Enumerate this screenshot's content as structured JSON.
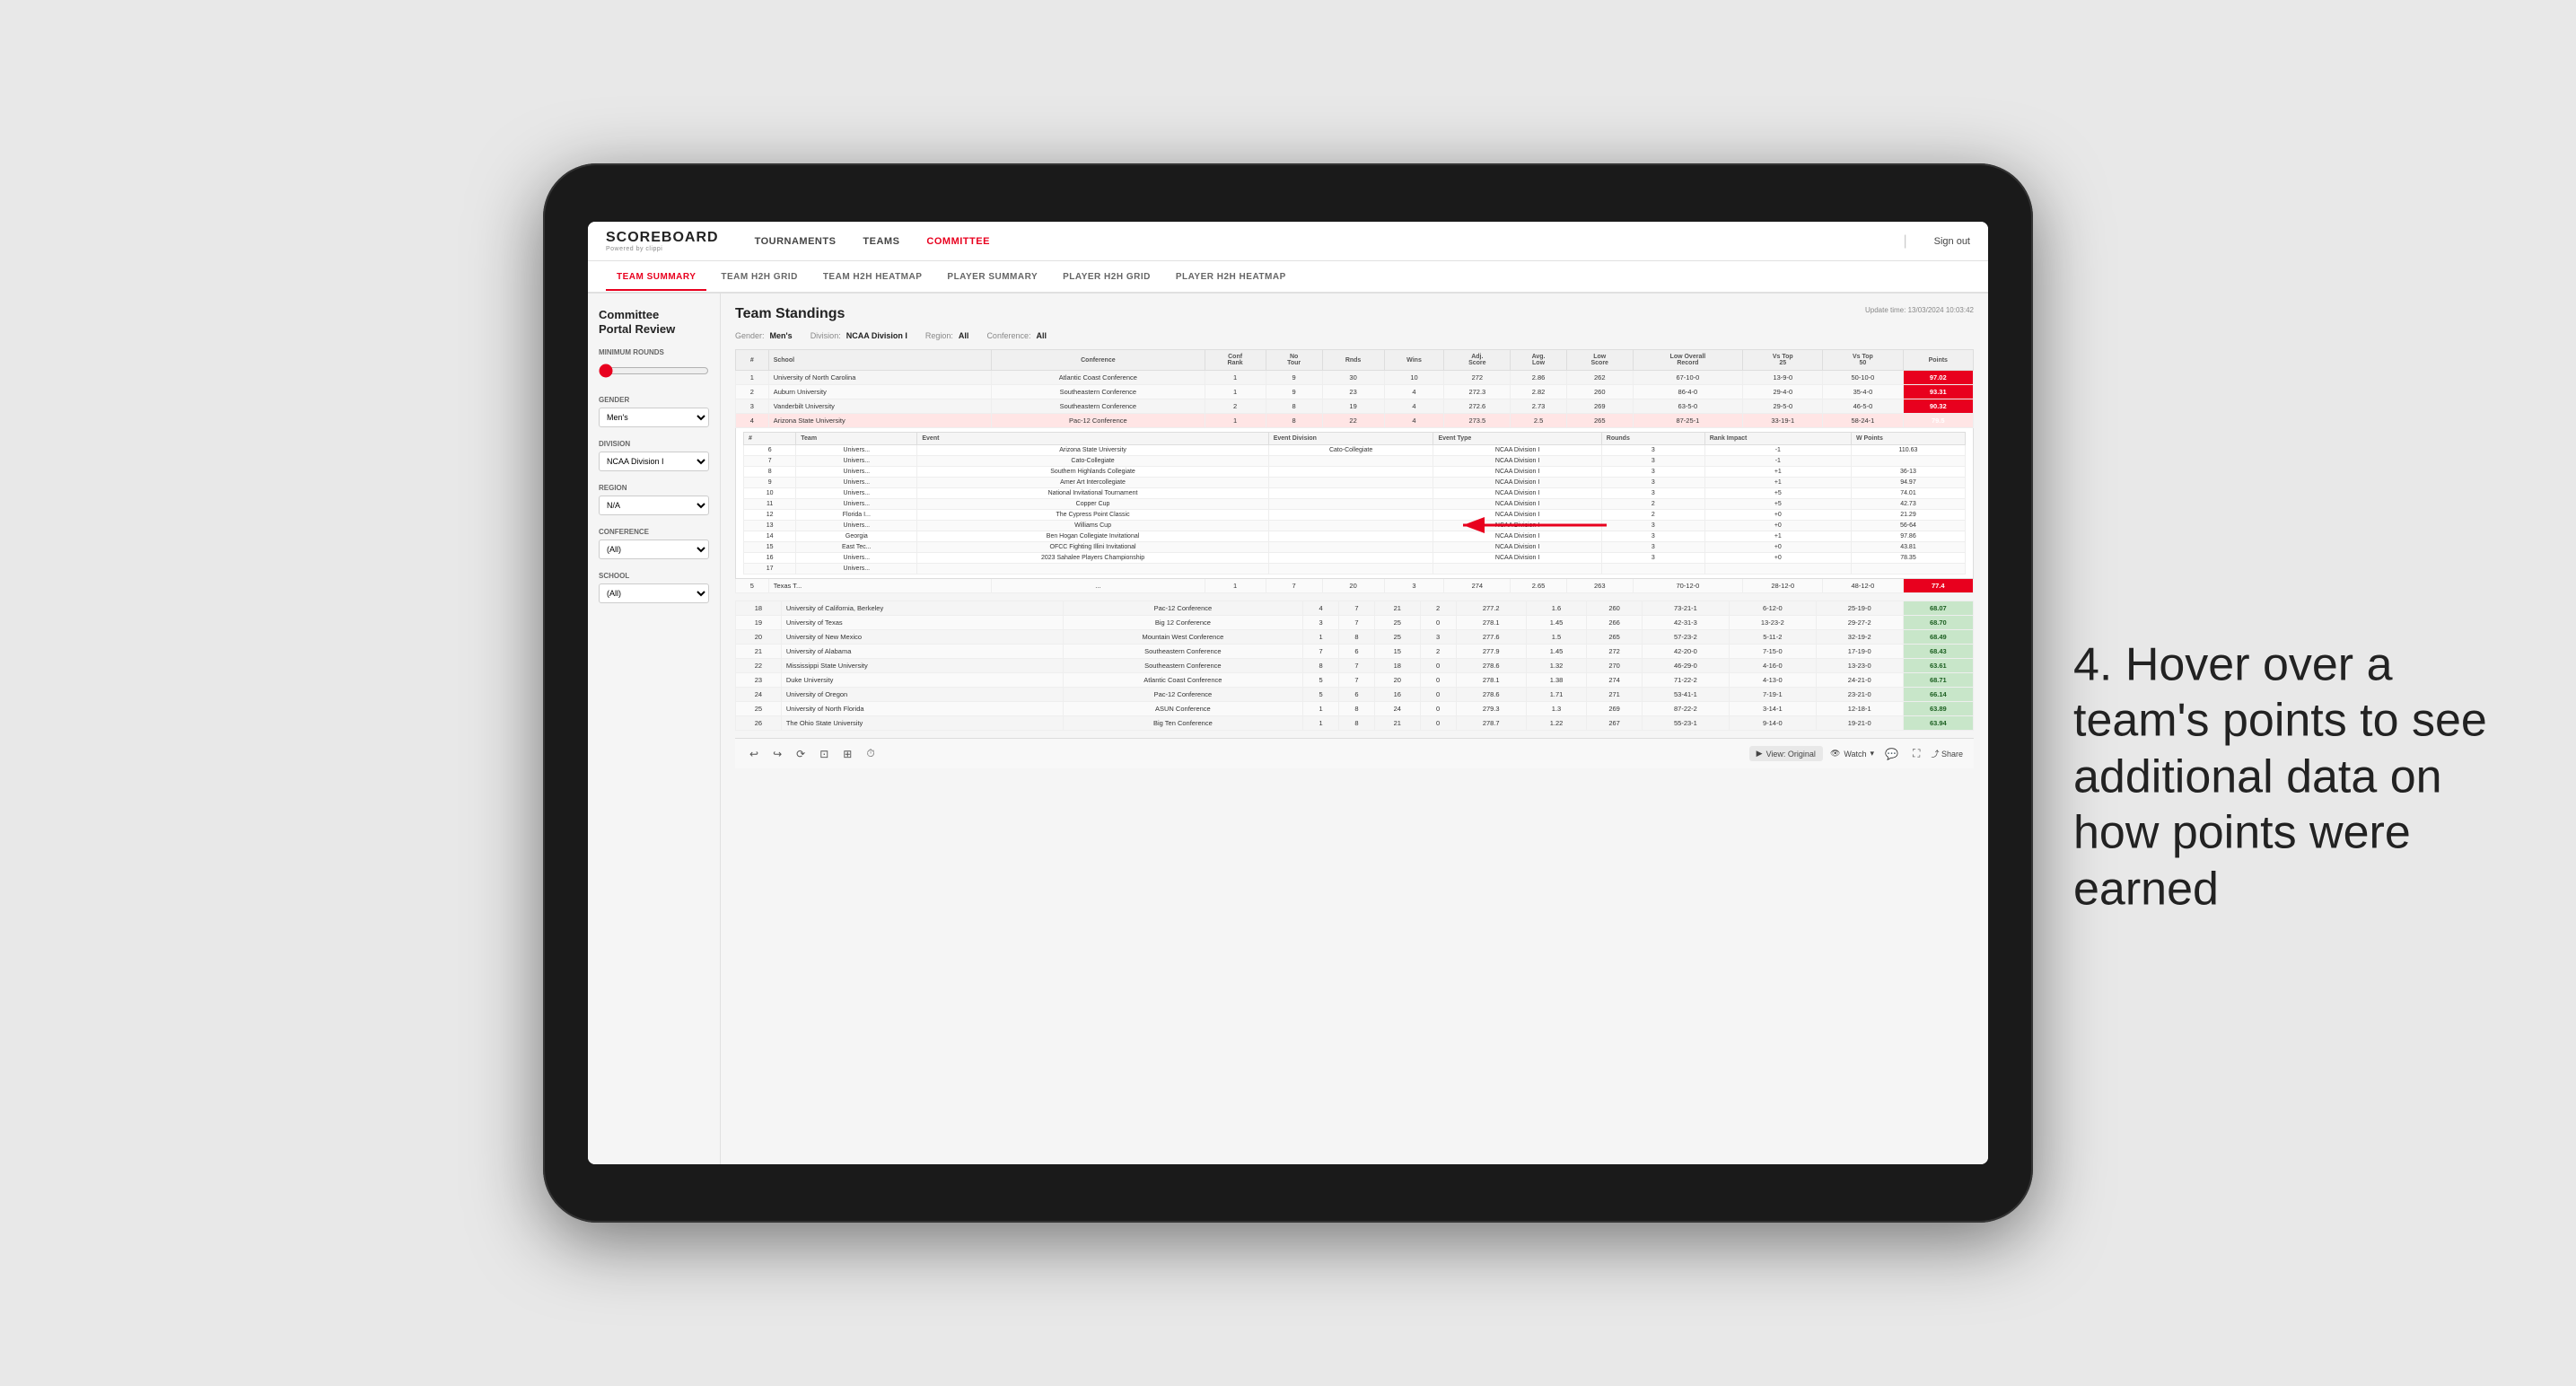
{
  "app": {
    "logo": "SCOREBOARD",
    "logo_sub": "Powered by clippi",
    "sign_out": "Sign out"
  },
  "nav": {
    "items": [
      {
        "label": "TOURNAMENTS",
        "active": false
      },
      {
        "label": "TEAMS",
        "active": false
      },
      {
        "label": "COMMITTEE",
        "active": true
      }
    ]
  },
  "sub_tabs": [
    {
      "label": "TEAM SUMMARY",
      "active": true
    },
    {
      "label": "TEAM H2H GRID",
      "active": false
    },
    {
      "label": "TEAM H2H HEATMAP",
      "active": false
    },
    {
      "label": "PLAYER SUMMARY",
      "active": false
    },
    {
      "label": "PLAYER H2H GRID",
      "active": false
    },
    {
      "label": "PLAYER H2H HEATMAP",
      "active": false
    }
  ],
  "sidebar": {
    "portal_title": "Committee",
    "portal_subtitle": "Portal Review",
    "min_rounds_label": "Minimum Rounds",
    "min_rounds_value": "0",
    "gender_label": "Gender",
    "gender_value": "Men's",
    "division_label": "Division",
    "division_value": "NCAA Division I",
    "region_label": "Region",
    "region_value": "N/A",
    "conference_label": "Conference",
    "conference_value": "(All)",
    "school_label": "School",
    "school_value": "(All)"
  },
  "panel": {
    "title": "Team Standings",
    "update_label": "Update time:",
    "update_time": "13/03/2024 10:03:42",
    "gender_label": "Gender:",
    "gender_value": "Men's",
    "division_label": "Division:",
    "division_value": "NCAA Division I",
    "region_label": "Region:",
    "region_value": "All",
    "conference_label": "Conference:",
    "conference_value": "All"
  },
  "table_headers": [
    "#",
    "School",
    "Conference",
    "Conf Rank",
    "No Tour",
    "Rnds",
    "Wins",
    "Adj Score",
    "Avg Low Score",
    "Low Overall Record",
    "Vs Top 25",
    "Vs Top 50",
    "Points"
  ],
  "teams": [
    {
      "rank": 1,
      "school": "University of North Carolina",
      "conference": "Atlantic Coast Conference",
      "conf_rank": 1,
      "tours": 9,
      "rounds": 30,
      "wins": 10,
      "adj_score": 272.0,
      "avg_low": 2.86,
      "low_score": 262,
      "overall": "67-10-0",
      "vs25": "13-9-0",
      "vs50": "50-10-0",
      "points": "97.02",
      "highlight": false
    },
    {
      "rank": 2,
      "school": "Auburn University",
      "conference": "Southeastern Conference",
      "conf_rank": 1,
      "tours": 9,
      "rounds": 23,
      "wins": 4,
      "adj_score": 272.3,
      "avg_low": 2.82,
      "low_score": 260,
      "overall": "86-4-0",
      "vs25": "29-4-0",
      "vs50": "35-4-0",
      "points": "93.31",
      "highlight": false
    },
    {
      "rank": 3,
      "school": "Vanderbilt University",
      "conference": "Southeastern Conference",
      "conf_rank": 2,
      "tours": 8,
      "rounds": 19,
      "wins": 4,
      "adj_score": 272.6,
      "avg_low": 2.73,
      "low_score": 269,
      "overall": "63-5-0",
      "vs25": "29-5-0",
      "vs50": "46-5-0",
      "points": "90.32",
      "highlight": false
    },
    {
      "rank": 4,
      "school": "Arizona State University",
      "conference": "Pac-12 Conference",
      "conf_rank": 1,
      "tours": 8,
      "rounds": 22,
      "wins": 4,
      "adj_score": 273.5,
      "avg_low": 2.5,
      "low_score": 265,
      "overall": "87-25-1",
      "vs25": "33-19-1",
      "vs50": "58-24-1",
      "points": "79.5",
      "highlight": true
    },
    {
      "rank": 5,
      "school": "Texas T...",
      "conference": "...",
      "conf_rank": 1,
      "tours": 7,
      "rounds": 20,
      "wins": 3,
      "adj_score": 274.0,
      "avg_low": 2.65,
      "low_score": 263,
      "overall": "70-12-0",
      "vs25": "28-12-0",
      "vs50": "48-12-0",
      "points": "77.4",
      "highlight": false
    }
  ],
  "hover_table": {
    "visible": true,
    "team": "Arizona State University",
    "headers": [
      "#",
      "Team",
      "Event",
      "Event Division",
      "Event Type",
      "Rounds",
      "Rank Impact",
      "W Points"
    ],
    "rows": [
      {
        "rank": 6,
        "team": "Univers...",
        "event": "Arizona State University",
        "event_div": "Cato-Collegiate",
        "event_type": "NCAA Division I",
        "rounds": 3,
        "rank_impact": "-1",
        "w_points": "110.63"
      },
      {
        "rank": 7,
        "team": "Univers...",
        "event": "Cato-Collegiate",
        "event_div": "",
        "event_type": "NCAA Division I",
        "rounds": 3,
        "rank_impact": "-1",
        "w_points": ""
      },
      {
        "rank": 8,
        "team": "Univers...",
        "event": "Southern Highlands Collegiate",
        "event_div": "",
        "event_type": "NCAA Division I",
        "rounds": 3,
        "rank_impact": "+1",
        "w_points": "36-13"
      },
      {
        "rank": 9,
        "team": "Univers...",
        "event": "Amer Art Intercollegiate",
        "event_div": "",
        "event_type": "NCAA Division I",
        "rounds": 3,
        "rank_impact": "+1",
        "w_points": "94.97"
      },
      {
        "rank": 10,
        "team": "Univers...",
        "event": "National Invitational Tournament",
        "event_div": "",
        "event_type": "NCAA Division I",
        "rounds": 3,
        "rank_impact": "+5",
        "w_points": "74.01"
      },
      {
        "rank": 11,
        "team": "Univers...",
        "event": "Copper Cup",
        "event_div": "",
        "event_type": "NCAA Division I",
        "rounds": 2,
        "rank_impact": "+5",
        "w_points": "42.73"
      },
      {
        "rank": 12,
        "team": "Florida I...",
        "event": "The Cypress Point Classic",
        "event_div": "",
        "event_type": "NCAA Division I",
        "rounds": 2,
        "rank_impact": "+0",
        "w_points": "21.29"
      },
      {
        "rank": 13,
        "team": "Univers...",
        "event": "Williams Cup",
        "event_div": "",
        "event_type": "NCAA Division I",
        "rounds": 3,
        "rank_impact": "+0",
        "w_points": "56-64"
      },
      {
        "rank": 14,
        "team": "Georgia",
        "event": "Ben Hogan Collegiate Invitational",
        "event_div": "",
        "event_type": "NCAA Division I",
        "rounds": 3,
        "rank_impact": "+1",
        "w_points": "97.86"
      },
      {
        "rank": 15,
        "team": "East Tec...",
        "event": "OFCC Fighting Illini Invitational",
        "event_div": "",
        "event_type": "NCAA Division I",
        "rounds": 3,
        "rank_impact": "+0",
        "w_points": "43.81"
      },
      {
        "rank": 16,
        "team": "Univers...",
        "event": "2023 Sahalee Players Championship",
        "event_div": "",
        "event_type": "NCAA Division I",
        "rounds": 3,
        "rank_impact": "+0",
        "w_points": "78.35"
      },
      {
        "rank": 17,
        "team": "Univers...",
        "event": "",
        "event_div": "",
        "event_type": "",
        "rounds": null,
        "rank_impact": "",
        "w_points": ""
      }
    ]
  },
  "lower_teams": [
    {
      "rank": 18,
      "school": "University of California, Berkeley",
      "conference": "Pac-12 Conference",
      "conf_rank": 4,
      "tours": 7,
      "rounds": 21,
      "wins": 2,
      "adj_score": 277.2,
      "avg_low": 1.6,
      "low_score": 260,
      "overall": "73-21-1",
      "vs25": "6-12-0",
      "vs50": "25-19-0",
      "points": "68.07"
    },
    {
      "rank": 19,
      "school": "University of Texas",
      "conference": "Big 12 Conference",
      "conf_rank": 3,
      "tours": 7,
      "rounds": 25,
      "wins": 0,
      "adj_score": 278.1,
      "avg_low": 1.45,
      "low_score": 266,
      "overall": "42-31-3",
      "vs25": "13-23-2",
      "vs50": "29-27-2",
      "points": "68.70"
    },
    {
      "rank": 20,
      "school": "University of New Mexico",
      "conference": "Mountain West Conference",
      "conf_rank": 1,
      "tours": 8,
      "rounds": 25,
      "wins": 3,
      "adj_score": 277.6,
      "avg_low": 1.5,
      "low_score": 265,
      "overall": "57-23-2",
      "vs25": "5-11-2",
      "vs50": "32-19-2",
      "points": "68.49"
    },
    {
      "rank": 21,
      "school": "University of Alabama",
      "conference": "Southeastern Conference",
      "conf_rank": 7,
      "tours": 6,
      "rounds": 15,
      "wins": 2,
      "adj_score": 277.9,
      "avg_low": 1.45,
      "low_score": 272,
      "overall": "42-20-0",
      "vs25": "7-15-0",
      "vs50": "17-19-0",
      "points": "68.43"
    },
    {
      "rank": 22,
      "school": "Mississippi State University",
      "conference": "Southeastern Conference",
      "conf_rank": 8,
      "tours": 7,
      "rounds": 18,
      "wins": 0,
      "adj_score": 278.6,
      "avg_low": 1.32,
      "low_score": 270,
      "overall": "46-29-0",
      "vs25": "4-16-0",
      "vs50": "13-23-0",
      "points": "63.61"
    },
    {
      "rank": 23,
      "school": "Duke University",
      "conference": "Atlantic Coast Conference",
      "conf_rank": 5,
      "tours": 7,
      "rounds": 20,
      "wins": 0,
      "adj_score": 278.1,
      "avg_low": 1.38,
      "low_score": 274,
      "overall": "71-22-2",
      "vs25": "4-13-0",
      "vs50": "24-21-0",
      "points": "68.71"
    },
    {
      "rank": 24,
      "school": "University of Oregon",
      "conference": "Pac-12 Conference",
      "conf_rank": 5,
      "tours": 6,
      "rounds": 16,
      "wins": 0,
      "adj_score": 278.6,
      "avg_low": 1.71,
      "low_score": 271,
      "overall": "53-41-1",
      "vs25": "7-19-1",
      "vs50": "23-21-0",
      "points": "66.14"
    },
    {
      "rank": 25,
      "school": "University of North Florida",
      "conference": "ASUN Conference",
      "conf_rank": 1,
      "tours": 8,
      "rounds": 24,
      "wins": 0,
      "adj_score": 279.3,
      "avg_low": 1.3,
      "low_score": 269,
      "overall": "87-22-2",
      "vs25": "3-14-1",
      "vs50": "12-18-1",
      "points": "63.89"
    },
    {
      "rank": 26,
      "school": "The Ohio State University",
      "conference": "Big Ten Conference",
      "conf_rank": 1,
      "tours": 8,
      "rounds": 21,
      "wins": 0,
      "adj_score": 278.7,
      "avg_low": 1.22,
      "low_score": 267,
      "overall": "55-23-1",
      "vs25": "9-14-0",
      "vs50": "19-21-0",
      "points": "63.94"
    }
  ],
  "toolbar": {
    "view_label": "View: Original",
    "watch_label": "Watch",
    "share_label": "Share"
  },
  "annotation": {
    "text": "4. Hover over a team's points to see additional data on how points were earned"
  }
}
